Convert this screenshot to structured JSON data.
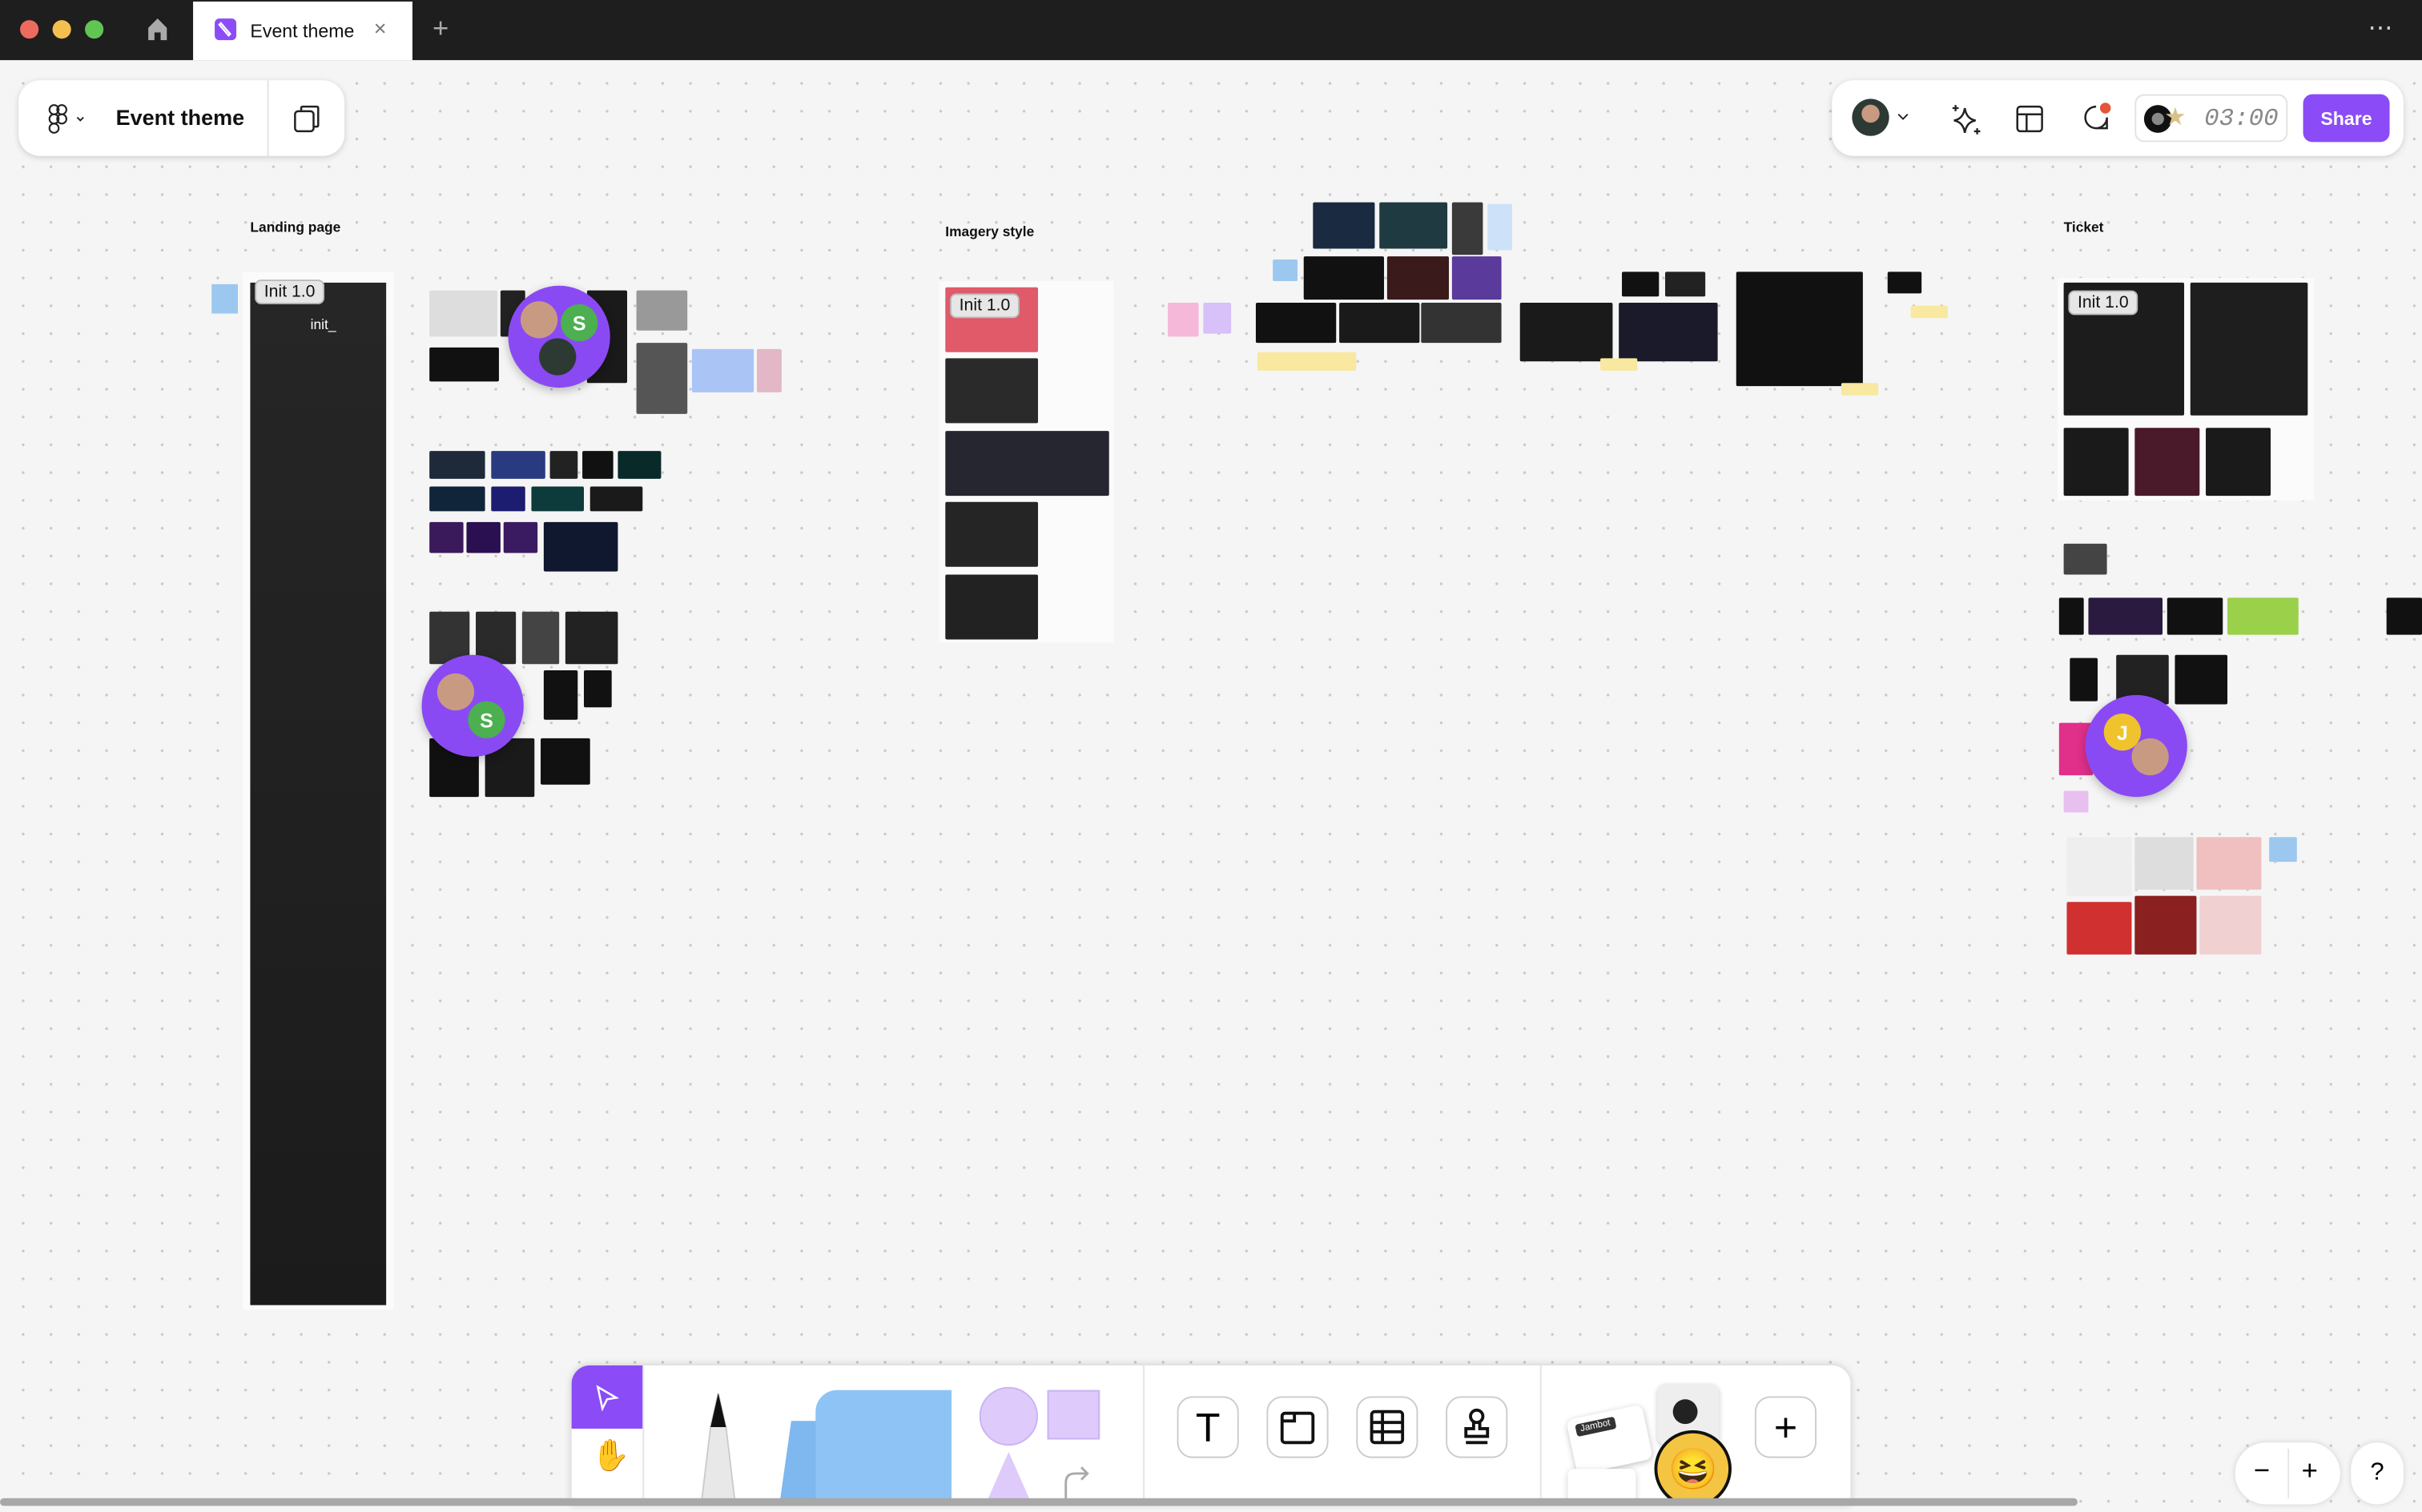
{
  "titlebar": {
    "tab_title": "Event theme",
    "new_tab": "+",
    "more": "⋯"
  },
  "file": {
    "name": "Event theme"
  },
  "toolbar_right": {
    "timer": "03:00",
    "share_label": "Share",
    "notification_color": "#e5553a"
  },
  "canvas": {
    "sections": [
      {
        "label": "Landing page"
      },
      {
        "label": "Imagery style"
      },
      {
        "label": "Ticket"
      }
    ],
    "badges": [
      "Init 1.0",
      "Init 1.0",
      "Init 1.0"
    ],
    "landing_logo": "init_",
    "cursors": [
      {
        "initial": "S",
        "color": "#4caf50"
      },
      {
        "initial": "S",
        "color": "#4caf50"
      },
      {
        "initial": "J",
        "color": "#f0c32c"
      }
    ]
  },
  "bottom_toolbar": {
    "jambot_label": "Jambot",
    "add_label": "+",
    "text_tool": "T"
  },
  "zoom": {
    "minus": "−",
    "plus": "+",
    "help": "?"
  },
  "colors": {
    "accent": "#8b4cf7",
    "titlebar": "#1e1e1e",
    "canvas": "#f5f5f5"
  }
}
